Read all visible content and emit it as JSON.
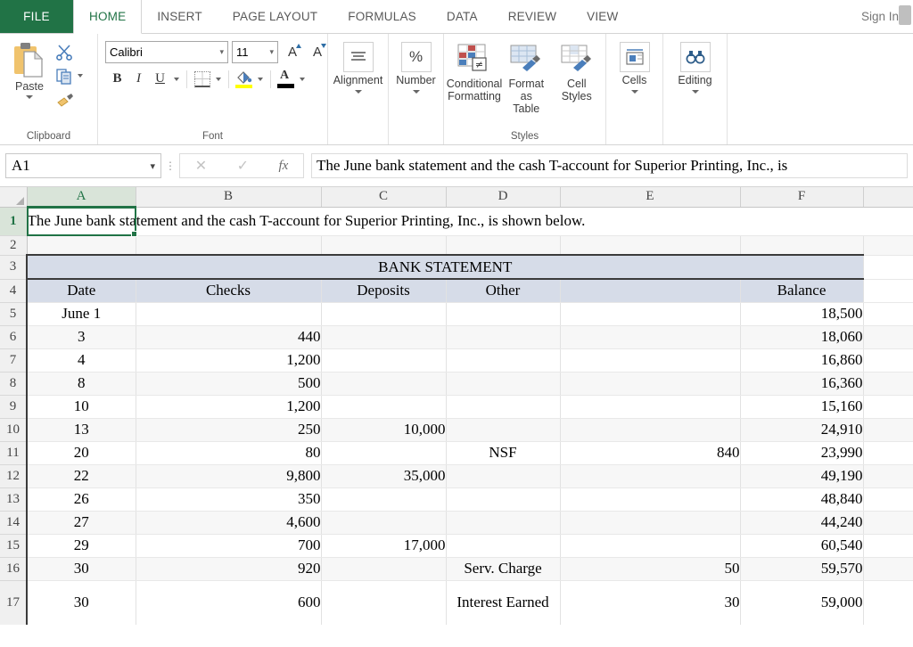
{
  "window": {
    "file_tab": "FILE",
    "sign_in": "Sign In",
    "tabs": [
      {
        "label": "HOME",
        "active": true
      },
      {
        "label": "INSERT",
        "active": false
      },
      {
        "label": "PAGE LAYOUT",
        "active": false
      },
      {
        "label": "FORMULAS",
        "active": false
      },
      {
        "label": "DATA",
        "active": false
      },
      {
        "label": "REVIEW",
        "active": false
      },
      {
        "label": "VIEW",
        "active": false
      }
    ]
  },
  "ribbon": {
    "clipboard": {
      "group_label": "Clipboard",
      "paste_label": "Paste",
      "cut_icon": "scissors-icon",
      "copy_icon": "copy-icon",
      "format_painter_icon": "format-painter-icon"
    },
    "font": {
      "group_label": "Font",
      "font_name": "Calibri",
      "font_size": "11",
      "grow_font": "A",
      "shrink_font": "A",
      "bold": "B",
      "italic": "I",
      "underline": "U",
      "borders_icon": "borders-icon",
      "fill_color_icon": "fill-color-icon",
      "font_color_icon": "font-color-icon",
      "fill_color_hex": "#ffff00",
      "font_color_hex": "#000000"
    },
    "alignment": {
      "group_label": "Alignment",
      "icon": "align-icon"
    },
    "number": {
      "group_label": "Number",
      "icon": "percent-icon",
      "glyph": "%"
    },
    "styles": {
      "group_label": "Styles",
      "conditional_formatting": "Conditional\nFormatting",
      "format_as_table": "Format as\nTable",
      "cell_styles": "Cell\nStyles"
    },
    "cells": {
      "group_label": "Cells",
      "label": "Cells",
      "icon": "cells-icon"
    },
    "editing": {
      "group_label": "Editing",
      "label": "Editing",
      "icon": "binoculars-icon"
    }
  },
  "formula_bar": {
    "name_box": "A1",
    "cancel_icon": "cancel-x-icon",
    "enter_icon": "enter-check-icon",
    "function_icon": "fx-icon",
    "fx_label": "fx",
    "formula_value": "The June bank statement and the cash T-account for Superior Printing, Inc., is"
  },
  "sheet": {
    "columns": [
      "A",
      "B",
      "C",
      "D",
      "E",
      "F"
    ],
    "selected_cell": "A1",
    "row_numbers": [
      "1",
      "2",
      "3",
      "4",
      "5",
      "6",
      "7",
      "8",
      "9",
      "10",
      "11",
      "12",
      "13",
      "14",
      "15",
      "16",
      "17"
    ],
    "a1_text": "The June bank statement and the cash T-account for Superior Printing, Inc., is shown below.",
    "title_row": "BANK STATEMENT",
    "headers": {
      "date": "Date",
      "checks": "Checks",
      "deposits": "Deposits",
      "other": "Other",
      "blank": "",
      "balance": "Balance"
    },
    "rows": [
      {
        "row": "5",
        "date": "June 1",
        "checks": "",
        "deposits": "",
        "other": "",
        "amount": "",
        "balance": "18,500"
      },
      {
        "row": "6",
        "date": "3",
        "checks": "440",
        "deposits": "",
        "other": "",
        "amount": "",
        "balance": "18,060"
      },
      {
        "row": "7",
        "date": "4",
        "checks": "1,200",
        "deposits": "",
        "other": "",
        "amount": "",
        "balance": "16,860"
      },
      {
        "row": "8",
        "date": "8",
        "checks": "500",
        "deposits": "",
        "other": "",
        "amount": "",
        "balance": "16,360"
      },
      {
        "row": "9",
        "date": "10",
        "checks": "1,200",
        "deposits": "",
        "other": "",
        "amount": "",
        "balance": "15,160"
      },
      {
        "row": "10",
        "date": "13",
        "checks": "250",
        "deposits": "10,000",
        "other": "",
        "amount": "",
        "balance": "24,910"
      },
      {
        "row": "11",
        "date": "20",
        "checks": "80",
        "deposits": "",
        "other": "NSF",
        "amount": "840",
        "balance": "23,990"
      },
      {
        "row": "12",
        "date": "22",
        "checks": "9,800",
        "deposits": "35,000",
        "other": "",
        "amount": "",
        "balance": "49,190"
      },
      {
        "row": "13",
        "date": "26",
        "checks": "350",
        "deposits": "",
        "other": "",
        "amount": "",
        "balance": "48,840"
      },
      {
        "row": "14",
        "date": "27",
        "checks": "4,600",
        "deposits": "",
        "other": "",
        "amount": "",
        "balance": "44,240"
      },
      {
        "row": "15",
        "date": "29",
        "checks": "700",
        "deposits": "17,000",
        "other": "",
        "amount": "",
        "balance": "60,540"
      },
      {
        "row": "16",
        "date": "30",
        "checks": "920",
        "deposits": "",
        "other": "Serv. Charge",
        "amount": "50",
        "balance": "59,570"
      },
      {
        "row": "17",
        "date": "30",
        "checks": "600",
        "deposits": "",
        "other": "Interest Earned",
        "amount": "30",
        "balance": "59,000"
      }
    ]
  },
  "colors": {
    "accent_green": "#217346",
    "header_fill": "#d6dce8",
    "alt_row": "#f7f7f7"
  }
}
